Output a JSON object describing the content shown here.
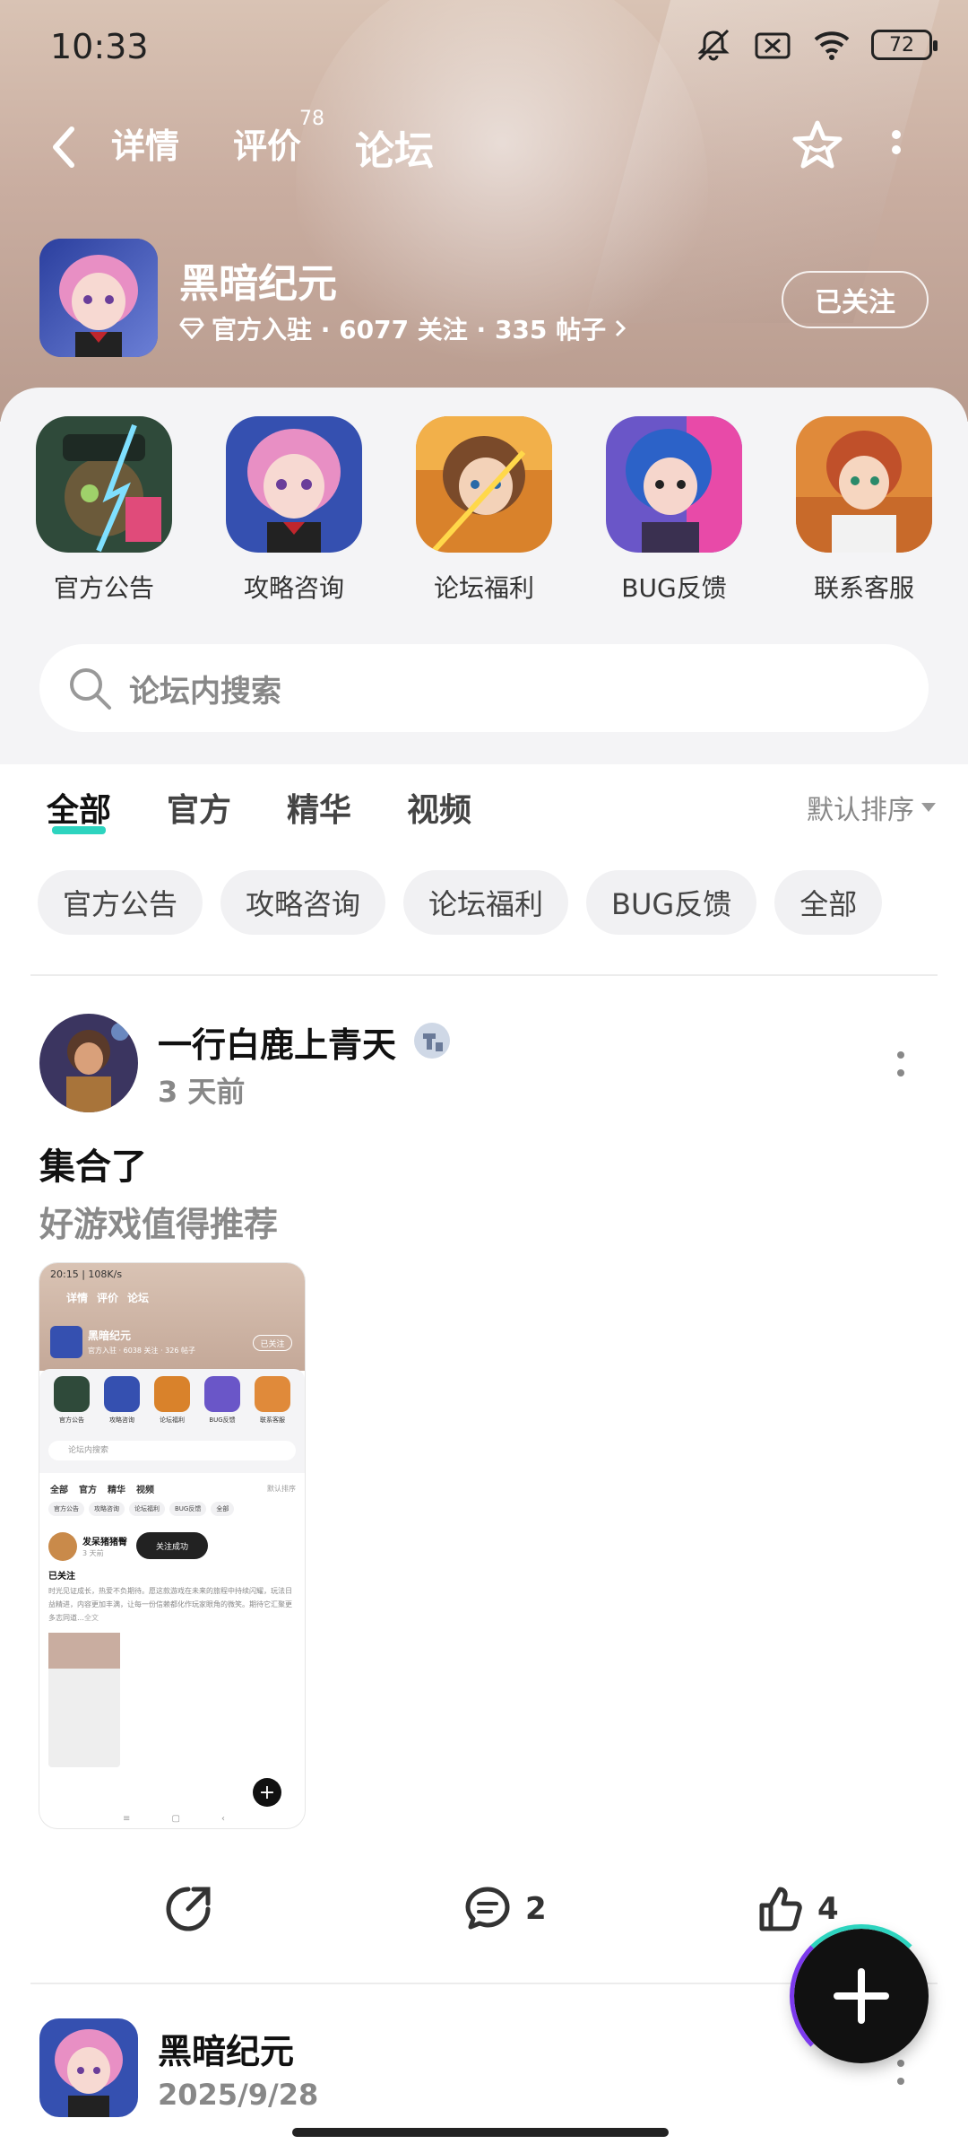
{
  "status": {
    "time": "10:33",
    "battery": "72"
  },
  "nav": {
    "tabs": [
      {
        "label": "详情",
        "sup": ""
      },
      {
        "label": "评价",
        "sup": "78"
      },
      {
        "label": "论坛",
        "sup": ""
      }
    ],
    "active_tab": "论坛"
  },
  "game": {
    "name": "黑暗纪元",
    "meta": "官方入驻 · 6077 关注 · 335 帖子",
    "follow_label": "已关注"
  },
  "categories": [
    {
      "label": "官方公告",
      "icon": "official-announcement-art"
    },
    {
      "label": "攻略咨询",
      "icon": "guide-art"
    },
    {
      "label": "论坛福利",
      "icon": "welfare-art"
    },
    {
      "label": "BUG反馈",
      "icon": "bug-feedback-art"
    },
    {
      "label": "联系客服",
      "icon": "customer-service-art"
    }
  ],
  "search": {
    "placeholder": "论坛内搜索"
  },
  "filters": {
    "tabs": [
      "全部",
      "官方",
      "精华",
      "视频"
    ],
    "sort_label": "默认排序"
  },
  "chips": [
    "官方公告",
    "攻略咨询",
    "论坛福利",
    "BUG反馈",
    "全部"
  ],
  "post": {
    "author": "一行白鹿上青天",
    "time": "3 天前",
    "title": "集合了",
    "body": "好游戏值得推荐",
    "comments": "2",
    "likes": "4"
  },
  "post2": {
    "author": "黑暗纪元",
    "time": "2025/9/28"
  },
  "shot": {
    "status": "20:15 | 108K/s",
    "tabs": [
      "详情",
      "评价",
      "论坛"
    ],
    "name": "黑暗纪元",
    "meta": "官方入驻 · 6038 关注 · 326 帖子",
    "follow": "已关注",
    "cats": [
      "官方公告",
      "攻略咨询",
      "论坛福利",
      "BUG反馈",
      "联系客服"
    ],
    "search": "论坛内搜索",
    "ftabs": [
      "全部",
      "官方",
      "精华",
      "视频"
    ],
    "sort": "默认排序",
    "chips": [
      "官方公告",
      "攻略咨询",
      "论坛福利",
      "BUG反馈",
      "全部"
    ],
    "author": "发呆猪猪臀",
    "time": "3 天前",
    "toast": "关注成功",
    "title": "已关注",
    "body": "时光见证成长，热爱不负期待。愿这款游戏在未来的旅程中持续闪耀，玩法日益精进，内容更加丰满，让每一份信赖都化作玩家眼角的微笑。期待它汇聚更多志同道…",
    "more": "全文"
  },
  "colors": {
    "accent": "#2dd4bf",
    "hero": "#c9ada0"
  }
}
